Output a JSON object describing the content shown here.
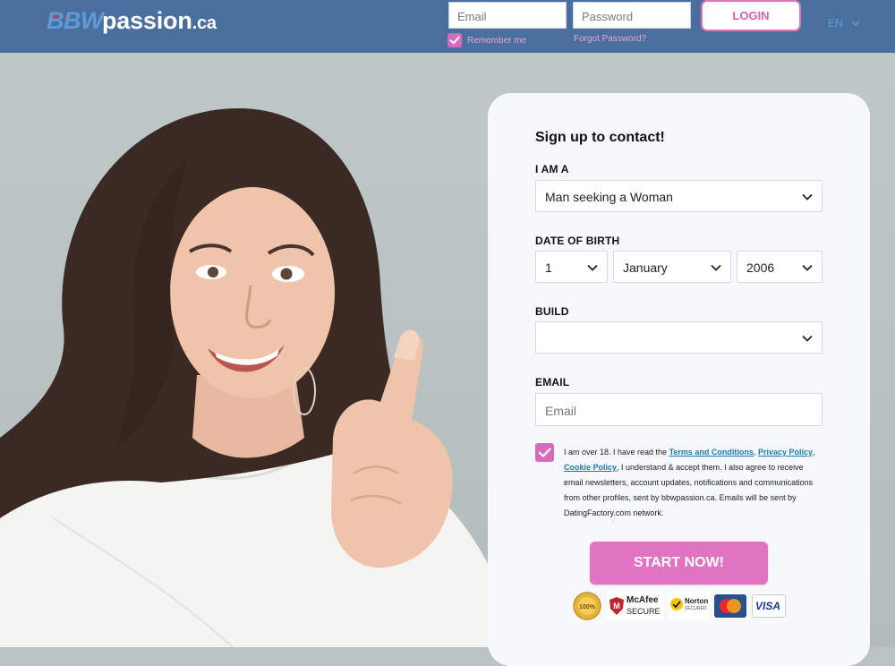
{
  "header": {
    "logo_part1": "BBW",
    "logo_part2": "passion",
    "logo_part3": ".ca",
    "email_placeholder": "Email",
    "password_placeholder": "Password",
    "login_label": "LOGIN",
    "remember_label": "Remember me",
    "forgot_label": "Forgot Password?",
    "language": "EN"
  },
  "form": {
    "title": "Sign up to contact!",
    "i_am_label": "I AM A",
    "i_am_value": "Man seeking a Woman",
    "dob_label": "DATE OF BIRTH",
    "dob_day": "1",
    "dob_month": "January",
    "dob_year": "2006",
    "build_label": "BUILD",
    "build_value": "",
    "email_label": "EMAIL",
    "email_placeholder": "Email",
    "agree_text_1": "I am over 18. I have read the ",
    "terms_link": "Terms and Conditions",
    "comma1": ", ",
    "privacy_link": "Privacy Policy",
    "comma2": ",",
    "cookie_link": "Cookie Policy",
    "agree_text_2": ", I understand & accept them. I also agree to receive email newsletters, account updates, notifications and communications from other profiles, sent by bbwpassion.ca. Emails will be sent by DatingFactory.com network.",
    "agree_checked": true,
    "start_label": "START NOW!"
  },
  "trust_badges": {
    "guarantee": "100%",
    "mcafee": "McAfee",
    "mcafee_sub": "SECURE",
    "norton": "Norton",
    "norton_sub": "SECURED",
    "visa": "VISA"
  },
  "colors": {
    "header_bg": "#4a6e9e",
    "accent_pink": "#e173c3",
    "card_bg": "#f7f8fc",
    "link_blue": "#1b7ab5"
  }
}
